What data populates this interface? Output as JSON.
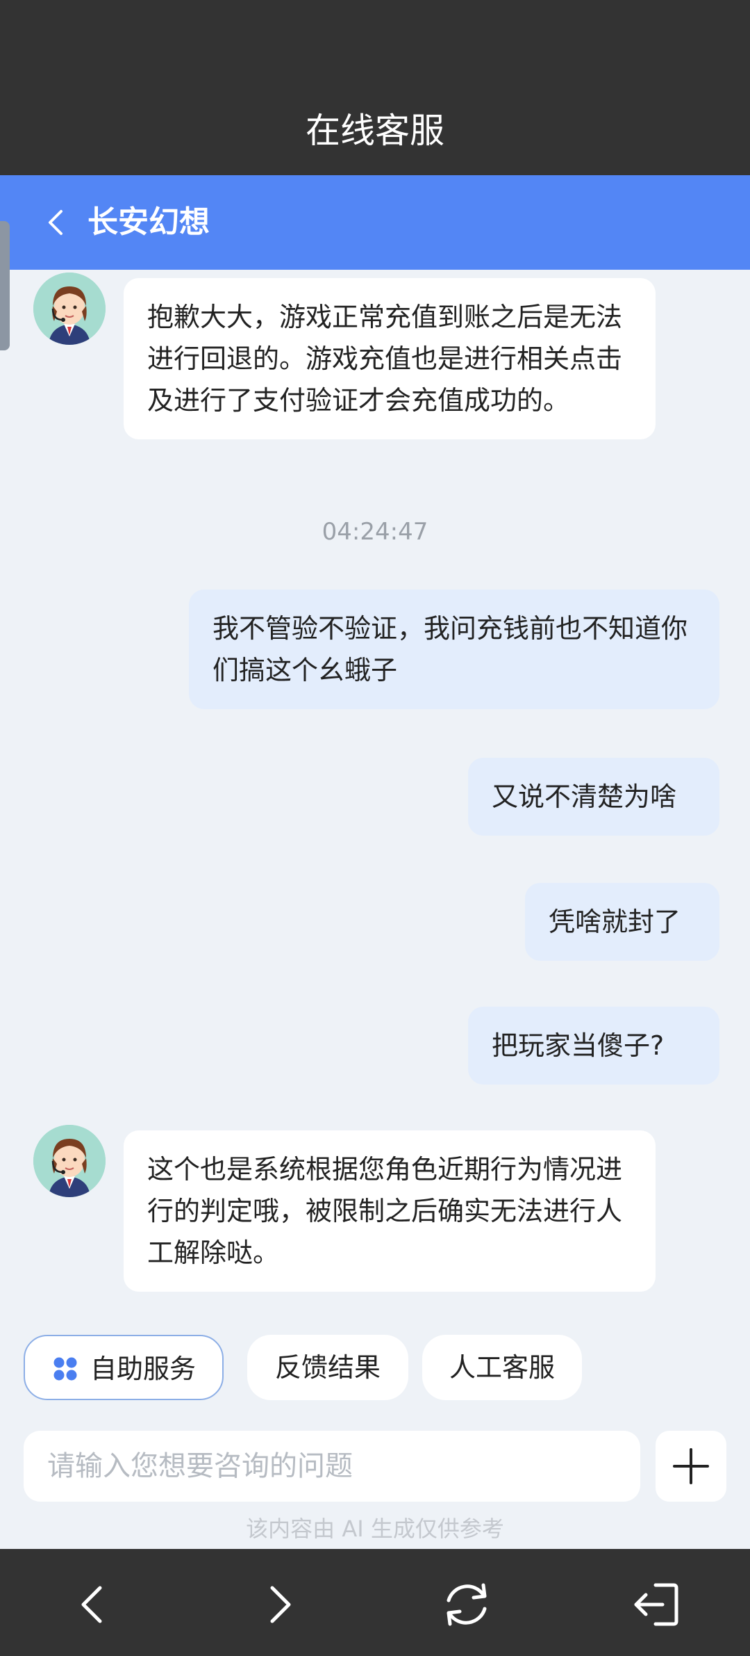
{
  "header": {
    "title": "在线客服"
  },
  "chat_header": {
    "title": "长安幻想"
  },
  "messages": [
    {
      "from": "bot",
      "text": "抱歉大大，游戏正常充值到账之后是无法进行回退的。游戏充值也是进行相关点击及进行了支付验证才会充值成功的。"
    },
    {
      "from": "user",
      "text": "我不管验不验证，我问充钱前也不知道你们搞这个幺蛾子"
    },
    {
      "from": "user",
      "text": "又说不清楚为啥"
    },
    {
      "from": "user",
      "text": "凭啥就封了"
    },
    {
      "from": "user",
      "text": "把玩家当傻子?"
    },
    {
      "from": "bot",
      "text": "这个也是系统根据您角色近期行为情况进行的判定哦，被限制之后确实无法进行人工解除哒。"
    }
  ],
  "timestamp": "04:24:47",
  "quick_actions": [
    "自助服务",
    "反馈结果",
    "人工客服"
  ],
  "input": {
    "placeholder": "请输入您想要咨询的问题"
  },
  "disclaimer": "该内容由 AI 生成仅供参考",
  "colors": {
    "top_bar": "#333333",
    "header_blue": "#5386f5",
    "background": "#eef2f7",
    "user_bubble": "#e3edfc",
    "icon_blue": "#4a7ef0"
  },
  "icons": [
    "back-chevron-icon",
    "avatar-agent-icon",
    "grid-icon",
    "plus-icon",
    "nav-back-icon",
    "nav-forward-icon",
    "refresh-icon",
    "exit-icon"
  ]
}
